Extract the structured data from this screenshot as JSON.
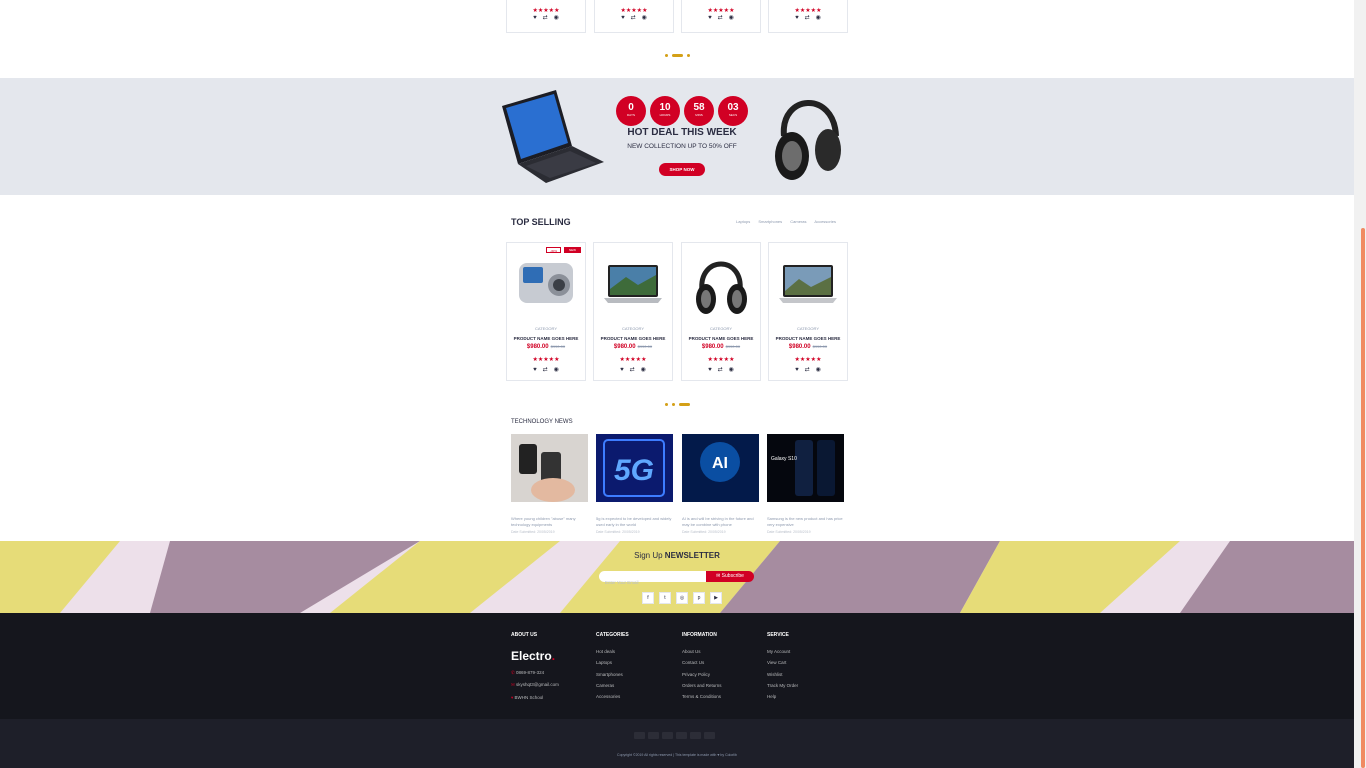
{
  "colors": {
    "accent": "#d10024",
    "dark": "#15161d",
    "bottom": "#1e1f29",
    "gold": "#d4a017",
    "hotdeal_bg": "#e4e7ed"
  },
  "top_row": {
    "stars": "★★★★★"
  },
  "hot_deal": {
    "countdown": [
      {
        "value": "0",
        "label": "DAYS"
      },
      {
        "value": "10",
        "label": "HOURS"
      },
      {
        "value": "58",
        "label": "MINS"
      },
      {
        "value": "03",
        "label": "SECS"
      }
    ],
    "title": "HOT DEAL THIS WEEK",
    "subtitle": "NEW COLLECTION UP TO 50% OFF",
    "button": "SHOP NOW"
  },
  "top_selling": {
    "title": "TOP SELLING",
    "tabs": [
      "Laptops",
      "Smartphones",
      "Cameras",
      "Accessories"
    ],
    "badges": {
      "sale": "-30%",
      "new": "NEW"
    },
    "products": [
      {
        "category": "CATEGORY",
        "name": "PRODUCT NAME GOES HERE",
        "price": "$980.00",
        "old_price": "$990.00",
        "stars": "★★★★★",
        "image": "camera-image"
      },
      {
        "category": "CATEGORY",
        "name": "PRODUCT NAME GOES HERE",
        "price": "$980.00",
        "old_price": "$990.00",
        "stars": "★★★★★",
        "image": "laptop-image"
      },
      {
        "category": "CATEGORY",
        "name": "PRODUCT NAME GOES HERE",
        "price": "$980.00",
        "old_price": "$990.00",
        "stars": "★★★★★",
        "image": "headphones-image"
      },
      {
        "category": "CATEGORY",
        "name": "PRODUCT NAME GOES HERE",
        "price": "$980.00",
        "old_price": "$990.00",
        "stars": "★★★★★",
        "image": "laptop-image"
      }
    ]
  },
  "news": {
    "title": "TECHNOLOGY NEWS",
    "items": [
      {
        "text": "Where young children \"abuse\" many technology equipments",
        "meta": "Date Submitted: 20/05/2019"
      },
      {
        "text": "5g is expected to be developed and widely used early in the world",
        "meta": "Date Submitted: 20/05/2019"
      },
      {
        "text": "AI is and will be striving in the future and may be combine with phone",
        "meta": "Date Submitted: 20/05/2019"
      },
      {
        "text": "Samsung is the new product and has price very expensive",
        "meta": "Date Submitted: 20/05/2019"
      }
    ],
    "galaxy_label": "Galaxy S10",
    "fiveg_label": "5G",
    "ai_label": "AI"
  },
  "newsletter": {
    "title_pre": "Sign Up",
    "title_bold": "NEWSLETTER",
    "placeholder": "Enter Your Email",
    "button": "Subscribe",
    "social": [
      "facebook-icon",
      "twitter-icon",
      "instagram-icon",
      "pinterest-icon",
      "youtube-icon"
    ]
  },
  "footer": {
    "about": {
      "title": "ABOUT US",
      "brand": "Electro",
      "brand_dot": ".",
      "phone": "0869-879-324",
      "email": "skyshqt3@gmail.com",
      "address": "BWHN School"
    },
    "categories": {
      "title": "CATEGORIES",
      "items": [
        "Hot deals",
        "Laptops",
        "Smartphones",
        "Cameras",
        "Accessories"
      ]
    },
    "information": {
      "title": "INFORMATION",
      "items": [
        "About Us",
        "Contact Us",
        "Privacy Policy",
        "Orders and Returns",
        "Terms & Conditions"
      ]
    },
    "service": {
      "title": "SERVICE",
      "items": [
        "My Account",
        "View Cart",
        "Wishlist",
        "Track My Order",
        "Help"
      ]
    },
    "copyright": "Copyright ©2019 All rights reserved | This template is made with ♥ by Colorlib"
  }
}
